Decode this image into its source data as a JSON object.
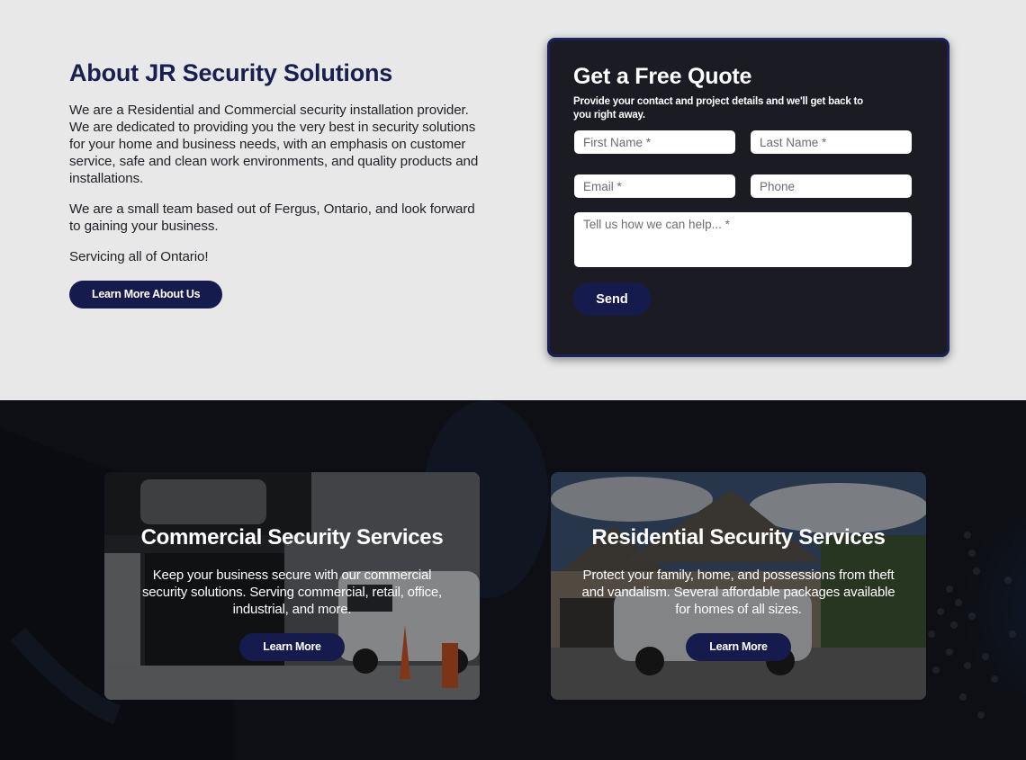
{
  "about": {
    "title": "About JR Security Solutions",
    "paragraphs": [
      "We are a Residential and Commercial security installation provider. We are dedicated to providing you the very best in security solutions for your home and business needs, with an emphasis on customer service, safe and clean work environments, and quality products and installations.",
      "We are a small team based out of Fergus, Ontario, and look forward to gaining your business.",
      "Servicing all of Ontario!"
    ],
    "button_label": "Learn More About Us"
  },
  "quote_form": {
    "title": "Get a Free Quote",
    "subtitle": "Provide your contact and project details and we'll get back to you right away.",
    "fields": {
      "first_name": {
        "placeholder": "First Name *",
        "value": ""
      },
      "last_name": {
        "placeholder": "Last Name *",
        "value": ""
      },
      "email": {
        "placeholder": "Email *",
        "value": ""
      },
      "phone": {
        "placeholder": "Phone",
        "value": ""
      },
      "message": {
        "placeholder": "Tell us how we can help... *",
        "value": ""
      }
    },
    "send_label": "Send"
  },
  "services": [
    {
      "title": "Commercial Security Services",
      "description": "Keep your business secure with our commercial security solutions. Serving commercial, retail, office, industrial, and more.",
      "button_label": "Learn More",
      "image_desc": "storefront-with-service-van"
    },
    {
      "title": "Residential Security Services",
      "description": "Protect your family, home, and possessions from theft and vandalism. Several affordable packages available for homes of all sizes.",
      "button_label": "Learn More",
      "image_desc": "house-with-service-van"
    }
  ],
  "colors": {
    "brand_navy": "#161b4d",
    "heading_navy": "#1a1f4f",
    "form_bg": "#1a1b23",
    "page_bg": "#e8e8e9",
    "dark_section_bg": "#0e0f14"
  }
}
